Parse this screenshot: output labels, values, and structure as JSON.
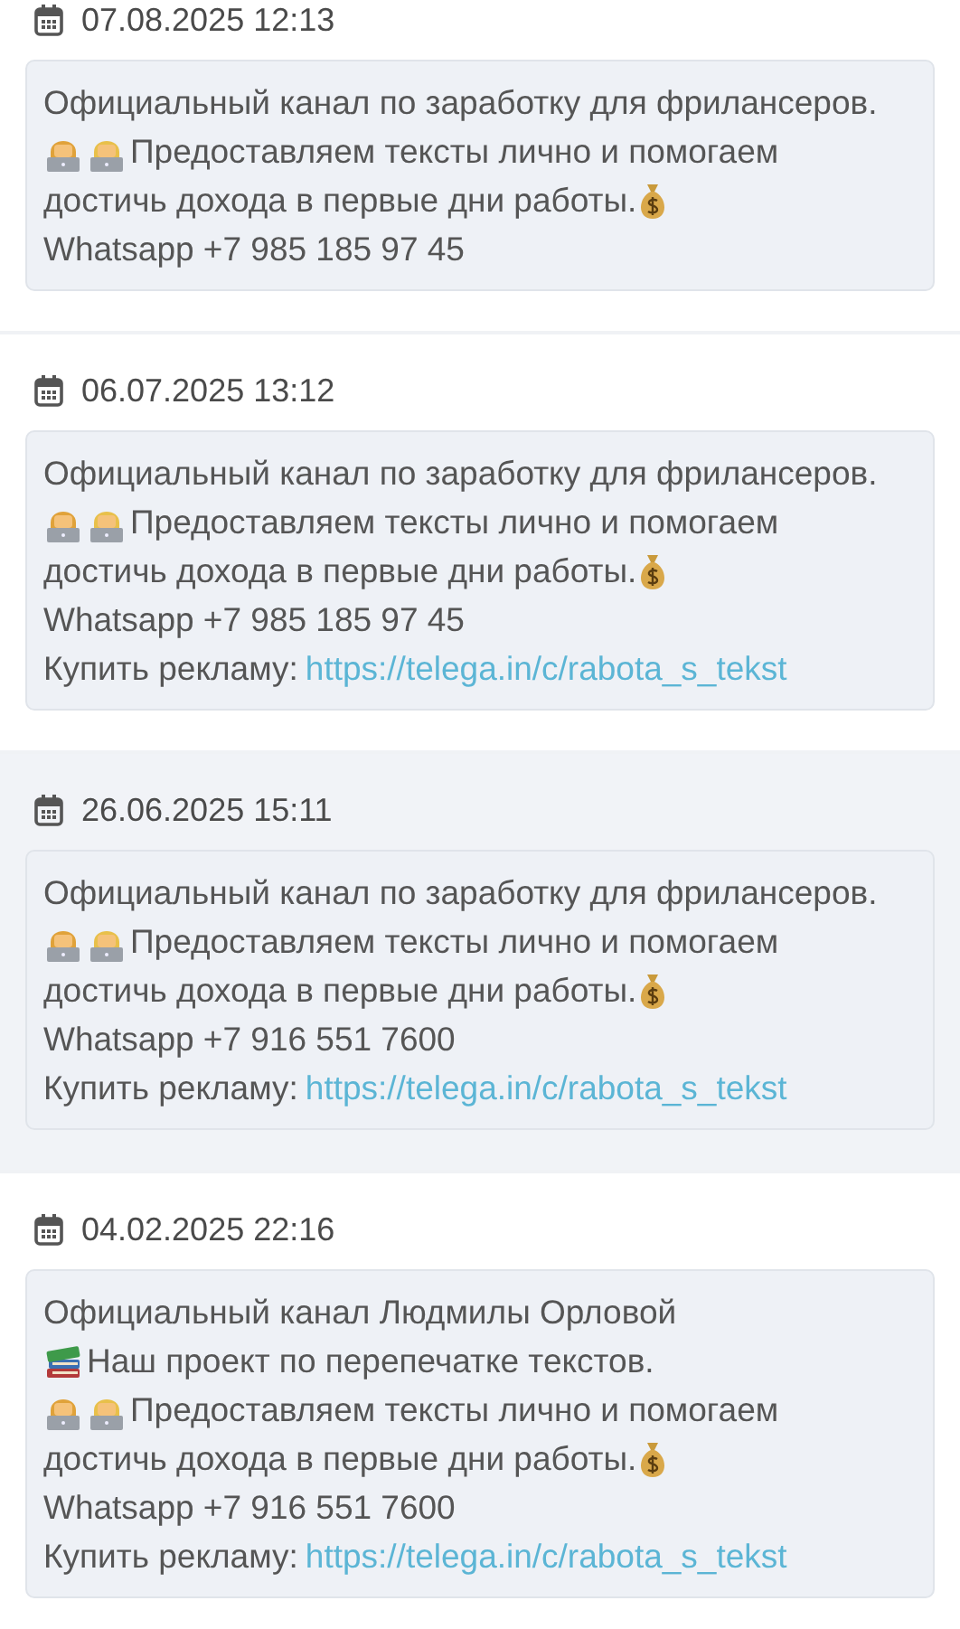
{
  "posts": [
    {
      "date": "07.08.2025 12:13",
      "highlighted": false,
      "lines": [
        {
          "kind": "text",
          "text": "Официальный канал по заработку для фрилансеров."
        },
        {
          "kind": "tech",
          "text": "Предоставляем тексты лично и помогаем"
        },
        {
          "kind": "money",
          "text": "достичь дохода в первые дни работы."
        },
        {
          "kind": "text",
          "text": "Whatsapp +7 985 185 97 45"
        }
      ]
    },
    {
      "date": "06.07.2025 13:12",
      "highlighted": false,
      "lines": [
        {
          "kind": "text",
          "text": "Официальный канал по заработку для фрилансеров."
        },
        {
          "kind": "tech",
          "text": "Предоставляем тексты лично и помогаем"
        },
        {
          "kind": "money",
          "text": "достичь дохода в первые дни работы."
        },
        {
          "kind": "text",
          "text": "Whatsapp +7 985 185 97 45"
        },
        {
          "kind": "ad",
          "text": "Купить рекламу:",
          "link": "https://telega.in/c/rabota_s_tekst"
        }
      ]
    },
    {
      "date": "26.06.2025 15:11",
      "highlighted": true,
      "lines": [
        {
          "kind": "text",
          "text": "Официальный канал по заработку для фрилансеров."
        },
        {
          "kind": "tech",
          "text": "Предоставляем тексты лично и помогаем"
        },
        {
          "kind": "money",
          "text": "достичь дохода в первые дни работы."
        },
        {
          "kind": "text",
          "text": "Whatsapp +7 916 551 7600"
        },
        {
          "kind": "ad",
          "text": "Купить рекламу:",
          "link": "https://telega.in/c/rabota_s_tekst"
        }
      ]
    },
    {
      "date": "04.02.2025 22:16",
      "highlighted": false,
      "lines": [
        {
          "kind": "text",
          "text": "Официальный канал Людмилы Орловой"
        },
        {
          "kind": "books",
          "text": "Наш проект по перепечатке текстов."
        },
        {
          "kind": "tech",
          "text": "Предоставляем тексты лично и помогаем"
        },
        {
          "kind": "money",
          "text": "достичь дохода в первые дни работы."
        },
        {
          "kind": "text",
          "text": "Whatsapp +7 916 551 7600"
        },
        {
          "kind": "ad",
          "text": "Купить рекламу:",
          "link": "https://telega.in/c/rabota_s_tekst"
        }
      ]
    }
  ]
}
